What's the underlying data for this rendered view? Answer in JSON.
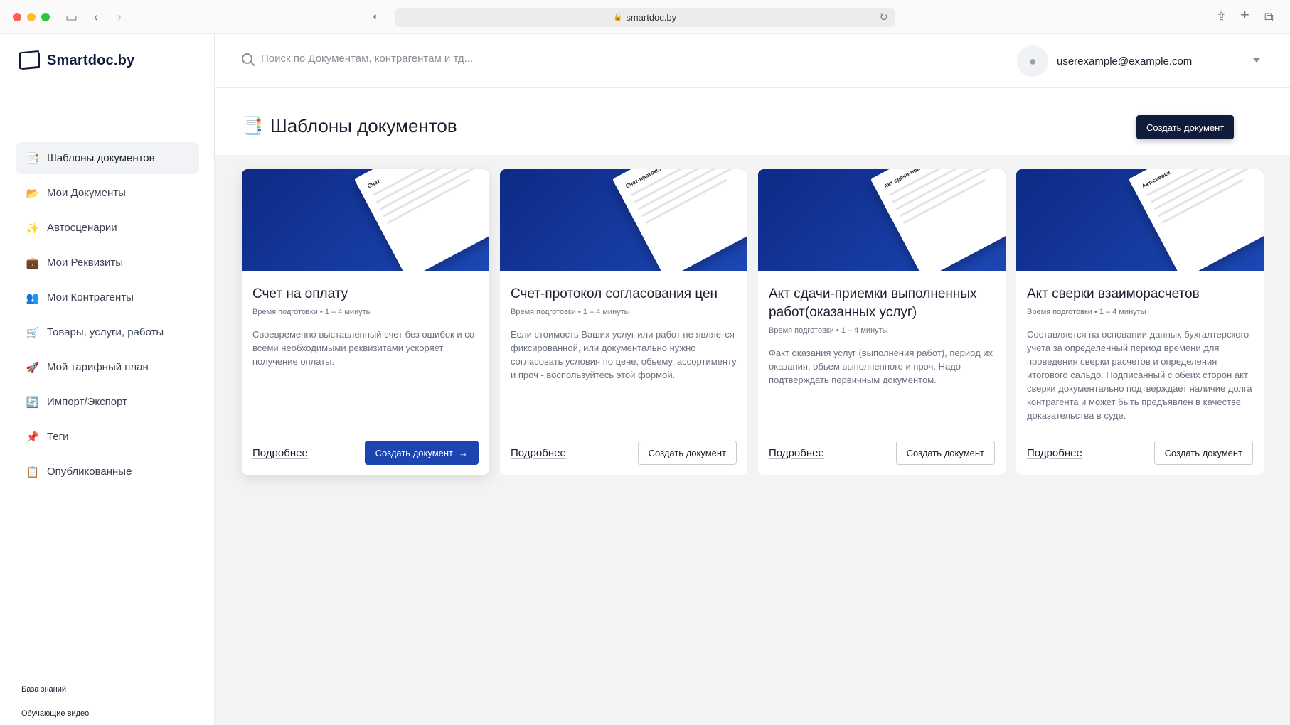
{
  "browser": {
    "url": "smartdoc.by",
    "traffic_colors": [
      "#ff5f57",
      "#febc2e",
      "#28c840"
    ]
  },
  "app": {
    "logo_text": "Smartdoc.by"
  },
  "sidebar": {
    "items": [
      {
        "label": "Шаблоны документов",
        "icon": "📑"
      },
      {
        "label": "Мои Документы",
        "icon": "📂"
      },
      {
        "label": "Автосценарии",
        "icon": "✨"
      },
      {
        "label": "Мои Реквизиты",
        "icon": "💼"
      },
      {
        "label": "Мои Контрагенты",
        "icon": "👥"
      },
      {
        "label": "Товары, услуги, работы",
        "icon": "🛒"
      },
      {
        "label": "Мой тарифный план",
        "icon": "🚀"
      },
      {
        "label": "Импорт/Экспорт",
        "icon": "🔄"
      },
      {
        "label": "Теги",
        "icon": "📌"
      },
      {
        "label": "Опубликованные",
        "icon": "📋"
      }
    ],
    "footer": {
      "knowledge_base": "База знаний",
      "videos": "Обучающие видео"
    }
  },
  "topbar": {
    "search_placeholder": "Поиск по Документам, контрагентам и тд...",
    "user_email": "userexample@example.com"
  },
  "page": {
    "title": "Шаблоны документов",
    "create_button": "Создать документ"
  },
  "cards": [
    {
      "paper_label": "Счет",
      "title": "Счет на оплату",
      "meta": "Время подготовки • 1 – 4 минуты",
      "description": "Своевременно выставленный счет без ошибок и со всеми необходимыми реквизитами ускоряет получение оплаты.",
      "more": "Подробнее",
      "button": "Создать документ",
      "button_arrow": "→"
    },
    {
      "paper_label": "Счет-протокол",
      "title": "Счет-протокол согласования цен",
      "meta": "Время подготовки • 1 – 4 минуты",
      "description": "Если стоимость Ваших услуг или работ не является фиксированной, или документально нужно согласовать условия по цене, обьему, ассортименту и проч - воспользуйтесь этой формой.",
      "more": "Подробнее",
      "button": "Создать документ"
    },
    {
      "paper_label": "Акт сдачи-приемки",
      "title": "Акт сдачи-приемки выполненных работ(оказанных услуг)",
      "meta": "Время подготовки • 1 – 4 минуты",
      "description": "Факт оказания услуг (выполнения работ), период их оказания, обьем выполненного и проч. Надо подтверждать первичным документом.",
      "more": "Подробнее",
      "button": "Создать документ"
    },
    {
      "paper_label": "Акт-сверки",
      "title": "Акт сверки взаиморасчетов",
      "meta": "Время подготовки • 1 – 4 минуты",
      "description": "Составляется на основании данных бухгалтерского учета за определенный период времени для проведения сверки расчетов и определения итогового сальдо. Подписанный с обеих сторон акт сверки документально подтверждает наличие долга контрагента и может быть предъявлен в качестве доказательства в суде.",
      "more": "Подробнее",
      "button": "Создать документ"
    }
  ],
  "colors": {
    "primary_dark": "#111c3c",
    "primary_blue": "#1d45b1",
    "banner_start": "#0d2a86",
    "banner_end": "#1c47b4"
  }
}
